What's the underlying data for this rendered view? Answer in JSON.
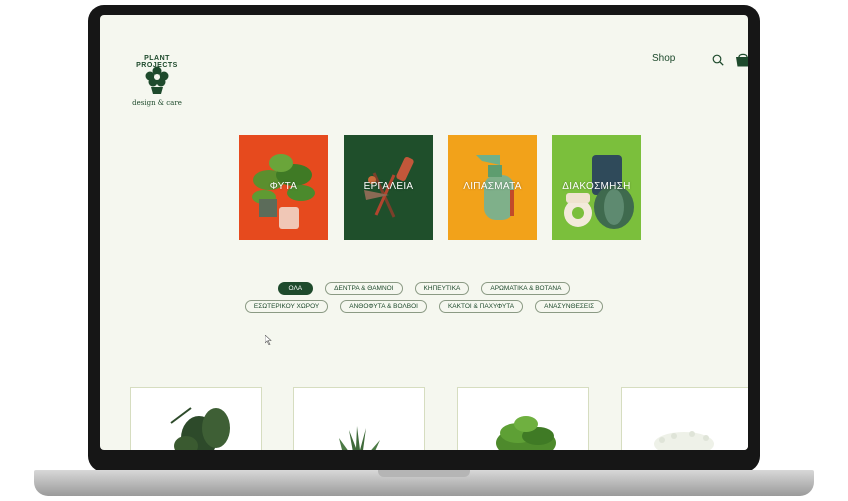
{
  "brand": {
    "logo_top": "PLANT PROJECTS",
    "logo_bottom": "design & care"
  },
  "nav": {
    "shop_label": "Shop",
    "search_icon": "search-icon",
    "cart_icon": "shopping-bag-icon"
  },
  "categories": [
    {
      "label": "ΦΥΤΑ",
      "color": "#e64a1e"
    },
    {
      "label": "ΕΡΓΑΛΕΙΑ",
      "color": "#1f4f2b"
    },
    {
      "label": "ΛΙΠΑΣΜΑΤΑ",
      "color": "#f2a21a"
    },
    {
      "label": "ΔΙΑΚΟΣΜΗΣΗ",
      "color": "#7bbf3c"
    }
  ],
  "filters": {
    "row1": [
      "ΟΛΑ",
      "ΔΕΝΤΡΑ & ΘΑΜΝΟΙ",
      "ΚΗΠΕΥΤΙΚΑ",
      "ΑΡΩΜΑΤΙΚΑ & ΒΟΤΑΝΑ"
    ],
    "row2": [
      "ΕΣΩΤΕΡΙΚΟΥ ΧΩΡΟΥ",
      "ΑΝΘΟΦΥΤΑ & ΒΟΛΒΟΙ",
      "ΚΑΚΤΟΙ & ΠΑΧΥΦΥΤΑ",
      "ΑΝΑΣΥΝΘΕΣΕΙΣ"
    ],
    "active": "ΟΛΑ"
  },
  "colors": {
    "brand_green": "#1e4a2c",
    "screen_bg": "#f5f7ef"
  }
}
